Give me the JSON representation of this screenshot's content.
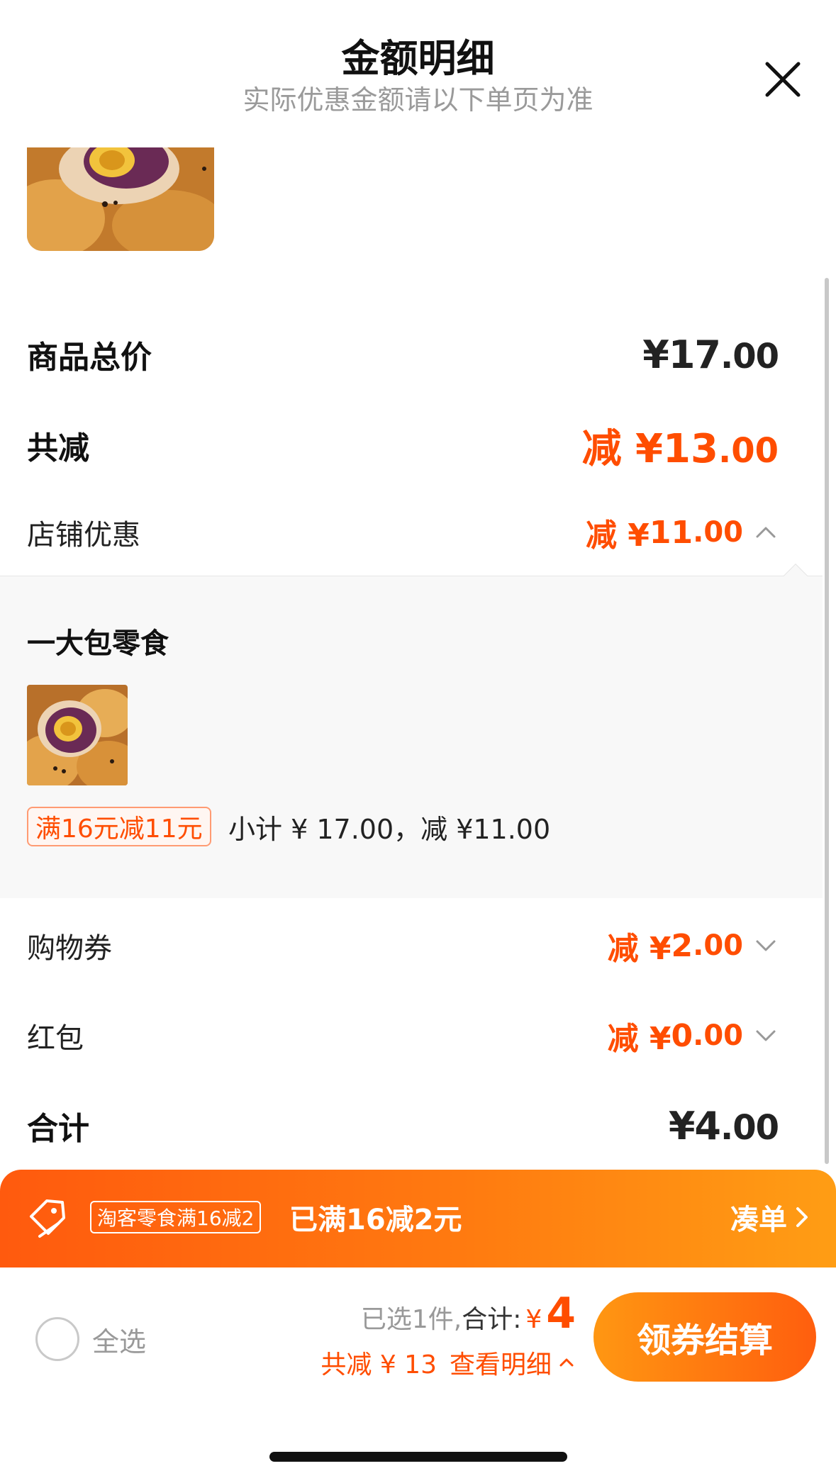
{
  "header": {
    "title": "金额明细",
    "subtitle": "实际优惠金额请以下单页为准"
  },
  "summary_rows": {
    "goods_total": {
      "label": "商品总价",
      "yen": "¥",
      "int": "17",
      "cents": ".00"
    },
    "total_discount": {
      "label": "共减",
      "prefix": "减 ¥",
      "int": "13",
      "cents": ".00"
    },
    "store_discount": {
      "label": "店铺优惠",
      "prefix": "减 ¥",
      "int": "11",
      "cents": ".00"
    },
    "coupon": {
      "label": "购物券",
      "prefix": "减 ¥",
      "int": "2",
      "cents": ".00"
    },
    "red_packet": {
      "label": "红包",
      "prefix": "减 ¥",
      "int": "0",
      "cents": ".00"
    },
    "grand_total": {
      "label": "合计",
      "yen": "¥",
      "int": "4",
      "cents": ".00"
    }
  },
  "store": {
    "name": "一大包零食",
    "promo_tag": "满16元减11元",
    "subtotal": "小计 ¥ 17.00，减 ¥11.00"
  },
  "banner": {
    "chip": "淘客零食满16减2",
    "text": "已满16减2元",
    "link": "凑单"
  },
  "bottom_bar": {
    "select_all": "全选",
    "selected_prefix": "已选1件,",
    "total_label": "合计:",
    "yen": "¥",
    "total_value": "4",
    "discount_text": "共减 ¥ 13",
    "view_detail": "查看明细",
    "checkout": "领券结算"
  },
  "colors": {
    "accent": "#ff4d00",
    "banner_start": "#ff5a0e",
    "banner_end": "#ff9d14"
  },
  "icons": {
    "close": "close-icon",
    "chevron_up": "chevron-up-icon",
    "chevron_down": "chevron-down-icon",
    "tag": "tag-icon",
    "chevron_right": "chevron-right-icon"
  }
}
